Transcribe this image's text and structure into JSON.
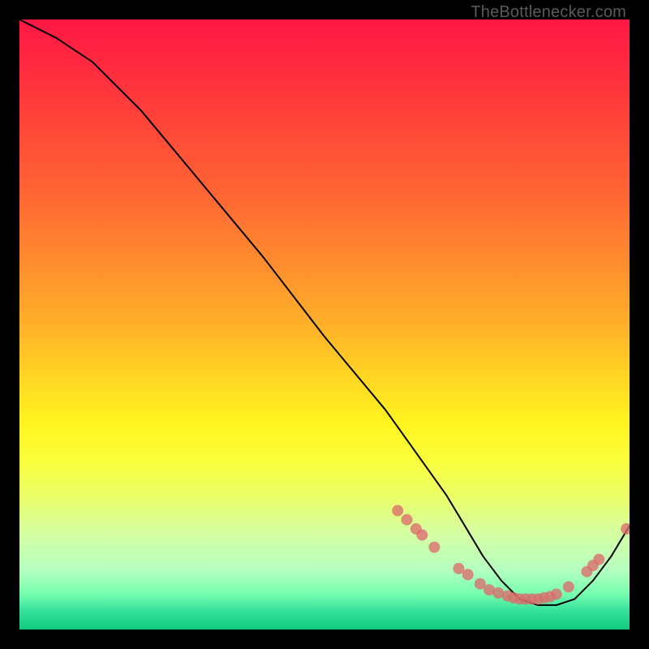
{
  "watermark": "TheBottlenecker.com",
  "chart_data": {
    "type": "line",
    "title": "",
    "xlabel": "",
    "ylabel": "",
    "xlim": [
      0,
      100
    ],
    "ylim": [
      0,
      100
    ],
    "series": [
      {
        "name": "curve",
        "x": [
          0,
          6,
          12,
          20,
          30,
          40,
          50,
          60,
          65,
          70,
          73,
          76,
          79,
          82,
          85,
          88,
          91,
          94,
          97,
          100
        ],
        "y": [
          100,
          97,
          93,
          85,
          73,
          61,
          48,
          36,
          29,
          22,
          17,
          12,
          8,
          5,
          4,
          4,
          5,
          8,
          12,
          17
        ]
      }
    ],
    "markers": [
      {
        "x": 62.0,
        "y": 19.5
      },
      {
        "x": 63.5,
        "y": 18.0
      },
      {
        "x": 65.0,
        "y": 16.5
      },
      {
        "x": 66.0,
        "y": 15.5
      },
      {
        "x": 68.0,
        "y": 13.5
      },
      {
        "x": 72.0,
        "y": 10.0
      },
      {
        "x": 73.5,
        "y": 9.0
      },
      {
        "x": 75.5,
        "y": 7.5
      },
      {
        "x": 77.0,
        "y": 6.5
      },
      {
        "x": 78.5,
        "y": 6.0
      },
      {
        "x": 80.0,
        "y": 5.5
      },
      {
        "x": 81.0,
        "y": 5.2
      },
      {
        "x": 82.0,
        "y": 5.0
      },
      {
        "x": 83.0,
        "y": 5.0
      },
      {
        "x": 84.0,
        "y": 5.0
      },
      {
        "x": 85.0,
        "y": 5.0
      },
      {
        "x": 86.0,
        "y": 5.2
      },
      {
        "x": 87.0,
        "y": 5.4
      },
      {
        "x": 88.0,
        "y": 5.8
      },
      {
        "x": 90.0,
        "y": 7.0
      },
      {
        "x": 93.0,
        "y": 9.5
      },
      {
        "x": 94.0,
        "y": 10.5
      },
      {
        "x": 95.0,
        "y": 11.5
      },
      {
        "x": 99.5,
        "y": 16.5
      }
    ],
    "marker_color": "#dd6b6b",
    "curve_color": "#000000"
  }
}
